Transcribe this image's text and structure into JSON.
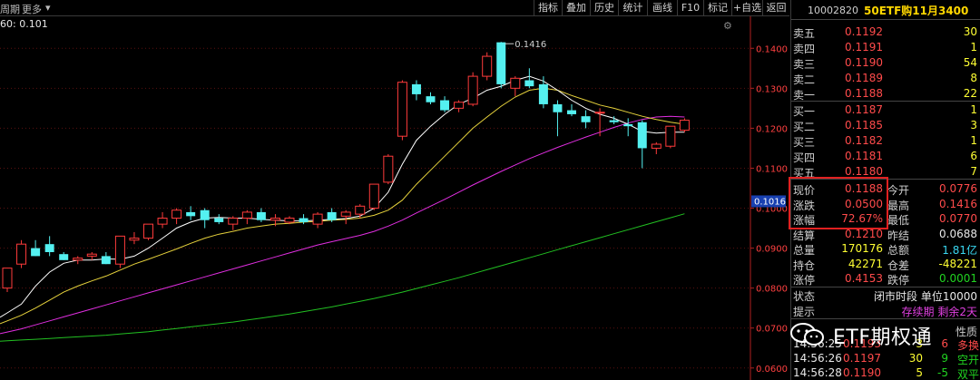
{
  "toolbar": {
    "left_label": "周期",
    "more_label": "更多",
    "buttons": [
      "指标",
      "叠加",
      "历史",
      "统计",
      "画线",
      "F10",
      "标记",
      "+自选",
      "返回"
    ]
  },
  "ma_label": "60: 0.101",
  "chart_data": {
    "type": "candlestick",
    "ylim": [
      0.057,
      0.148
    ],
    "y_ticks": [
      "0.1400",
      "0.1300",
      "0.1200",
      "0.1100",
      "0.1000",
      "0.0900",
      "0.0800",
      "0.0700",
      "0.0600"
    ],
    "tick_values": [
      0.14,
      0.13,
      0.12,
      0.11,
      0.1,
      0.09,
      0.08,
      0.07,
      0.06
    ],
    "current_value_tag": "0.1016",
    "high_label": "0.1416",
    "colors": {
      "up": "#ff3b3b",
      "down": "#54f0f0",
      "ma5": "#ffffff",
      "ma10": "#e6d23c",
      "ma20": "#e02ee0",
      "ma60": "#22c022"
    },
    "candles": [
      [
        0.08,
        0.085,
        0.079,
        0.085
      ],
      [
        0.086,
        0.092,
        0.085,
        0.091
      ],
      [
        0.09,
        0.092,
        0.088,
        0.088
      ],
      [
        0.091,
        0.093,
        0.088,
        0.089
      ],
      [
        0.0885,
        0.089,
        0.087,
        0.087
      ],
      [
        0.087,
        0.088,
        0.086,
        0.0875
      ],
      [
        0.088,
        0.089,
        0.087,
        0.0885
      ],
      [
        0.088,
        0.089,
        0.086,
        0.086
      ],
      [
        0.086,
        0.093,
        0.085,
        0.093
      ],
      [
        0.092,
        0.094,
        0.091,
        0.0925
      ],
      [
        0.0925,
        0.096,
        0.092,
        0.096
      ],
      [
        0.096,
        0.099,
        0.095,
        0.0975
      ],
      [
        0.0975,
        0.1,
        0.096,
        0.0995
      ],
      [
        0.099,
        0.1005,
        0.097,
        0.098
      ],
      [
        0.0995,
        0.1,
        0.095,
        0.097
      ],
      [
        0.0975,
        0.0985,
        0.096,
        0.0965
      ],
      [
        0.096,
        0.098,
        0.0945,
        0.0975
      ],
      [
        0.0975,
        0.0995,
        0.096,
        0.099
      ],
      [
        0.099,
        0.1,
        0.0965,
        0.097
      ],
      [
        0.097,
        0.0985,
        0.0955,
        0.0975
      ],
      [
        0.0965,
        0.098,
        0.096,
        0.0975
      ],
      [
        0.0975,
        0.0985,
        0.096,
        0.0965
      ],
      [
        0.096,
        0.099,
        0.095,
        0.0985
      ],
      [
        0.099,
        0.1,
        0.0965,
        0.097
      ],
      [
        0.098,
        0.0995,
        0.096,
        0.099
      ],
      [
        0.0985,
        0.101,
        0.0975,
        0.1005
      ],
      [
        0.1,
        0.106,
        0.0995,
        0.106
      ],
      [
        0.1065,
        0.1135,
        0.106,
        0.113
      ],
      [
        0.118,
        0.132,
        0.117,
        0.1315
      ],
      [
        0.131,
        0.132,
        0.127,
        0.1285
      ],
      [
        0.128,
        0.129,
        0.126,
        0.1265
      ],
      [
        0.127,
        0.128,
        0.124,
        0.1245
      ],
      [
        0.125,
        0.127,
        0.124,
        0.1265
      ],
      [
        0.126,
        0.134,
        0.1255,
        0.133
      ],
      [
        0.133,
        0.139,
        0.132,
        0.138
      ],
      [
        0.1415,
        0.1416,
        0.13,
        0.131
      ],
      [
        0.13,
        0.133,
        0.128,
        0.1325
      ],
      [
        0.132,
        0.135,
        0.13,
        0.1305
      ],
      [
        0.131,
        0.133,
        0.125,
        0.126
      ],
      [
        0.126,
        0.127,
        0.118,
        0.124
      ],
      [
        0.1245,
        0.126,
        0.123,
        0.1235
      ],
      [
        0.123,
        0.1245,
        0.12,
        0.1215
      ],
      [
        0.124,
        0.125,
        0.118,
        0.124
      ],
      [
        0.122,
        0.123,
        0.121,
        0.1215
      ],
      [
        0.121,
        0.1225,
        0.118,
        0.1205
      ],
      [
        0.1215,
        0.122,
        0.11,
        0.115
      ],
      [
        0.115,
        0.1165,
        0.1135,
        0.116
      ],
      [
        0.1155,
        0.1205,
        0.115,
        0.1205
      ],
      [
        0.1195,
        0.1225,
        0.119,
        0.122
      ]
    ],
    "ma5": [
      0.0738,
      0.076,
      0.0805,
      0.084,
      0.0862,
      0.087,
      0.087,
      0.0873,
      0.0872,
      0.088,
      0.09,
      0.0925,
      0.095,
      0.0965,
      0.0975,
      0.0977,
      0.0975,
      0.0975,
      0.0972,
      0.097,
      0.0968,
      0.0968,
      0.097,
      0.0972,
      0.0974,
      0.098,
      0.1,
      0.104,
      0.111,
      0.117,
      0.1205,
      0.1235,
      0.126,
      0.1275,
      0.1295,
      0.1305,
      0.132,
      0.133,
      0.1318,
      0.1295,
      0.127,
      0.125,
      0.1235,
      0.1225,
      0.121,
      0.1192,
      0.1188,
      0.119,
      0.119
    ],
    "ma10": [
      0.0718,
      0.0732,
      0.075,
      0.077,
      0.079,
      0.0805,
      0.0818,
      0.083,
      0.0845,
      0.086,
      0.0872,
      0.0885,
      0.0898,
      0.0912,
      0.0925,
      0.0935,
      0.0942,
      0.095,
      0.0955,
      0.096,
      0.0962,
      0.0965,
      0.0967,
      0.097,
      0.0972,
      0.0975,
      0.0982,
      0.0995,
      0.102,
      0.106,
      0.1095,
      0.113,
      0.1165,
      0.12,
      0.1228,
      0.1255,
      0.1278,
      0.1295,
      0.13,
      0.1295,
      0.1282,
      0.127,
      0.1258,
      0.125,
      0.124,
      0.123,
      0.1222,
      0.1215,
      0.121
    ],
    "ma20": [
      0.069,
      0.0698,
      0.0708,
      0.0718,
      0.0728,
      0.0738,
      0.0748,
      0.0758,
      0.0768,
      0.0778,
      0.0788,
      0.0798,
      0.0808,
      0.0818,
      0.0828,
      0.0838,
      0.0848,
      0.0858,
      0.0868,
      0.0878,
      0.0888,
      0.0898,
      0.0908,
      0.0916,
      0.0924,
      0.0932,
      0.0942,
      0.0955,
      0.097,
      0.0988,
      0.1005,
      0.1022,
      0.104,
      0.1058,
      0.1075,
      0.1092,
      0.1108,
      0.1124,
      0.1138,
      0.1152,
      0.1165,
      0.1178,
      0.119,
      0.1202,
      0.1213,
      0.1222,
      0.1228,
      0.123,
      0.1228
    ],
    "ma60": [
      0.0668,
      0.067,
      0.0672,
      0.0674,
      0.0676,
      0.0678,
      0.068,
      0.0682,
      0.0685,
      0.0688,
      0.0691,
      0.0695,
      0.0699,
      0.0703,
      0.0707,
      0.0711,
      0.0715,
      0.072,
      0.0725,
      0.073,
      0.0735,
      0.0741,
      0.0747,
      0.0753,
      0.076,
      0.0767,
      0.0774,
      0.0782,
      0.079,
      0.0799,
      0.0808,
      0.0817,
      0.0826,
      0.0836,
      0.0846,
      0.0856,
      0.0866,
      0.0876,
      0.0886,
      0.0896,
      0.0906,
      0.0916,
      0.0926,
      0.0936,
      0.0946,
      0.0956,
      0.0966,
      0.0976,
      0.0986
    ]
  },
  "quote": {
    "code": "10002820",
    "name": "50ETF购11月3400",
    "asks": [
      {
        "label": "卖五",
        "price": "0.1192",
        "vol": "30"
      },
      {
        "label": "卖四",
        "price": "0.1191",
        "vol": "1"
      },
      {
        "label": "卖三",
        "price": "0.1190",
        "vol": "54"
      },
      {
        "label": "卖二",
        "price": "0.1189",
        "vol": "8"
      },
      {
        "label": "卖一",
        "price": "0.1188",
        "vol": "22"
      }
    ],
    "bids": [
      {
        "label": "买一",
        "price": "0.1187",
        "vol": "1"
      },
      {
        "label": "买二",
        "price": "0.1185",
        "vol": "3"
      },
      {
        "label": "买三",
        "price": "0.1182",
        "vol": "1"
      },
      {
        "label": "买四",
        "price": "0.1181",
        "vol": "6"
      },
      {
        "label": "买五",
        "price": "0.1180",
        "vol": "7"
      }
    ],
    "stats": [
      {
        "k1": "现价",
        "v1": "0.1188",
        "c1": "red",
        "k2": "今开",
        "v2": "0.0776",
        "c2": "red"
      },
      {
        "k1": "涨跌",
        "v1": "0.0500",
        "c1": "red",
        "k2": "最高",
        "v2": "0.1416",
        "c2": "red"
      },
      {
        "k1": "涨幅",
        "v1": "72.67%",
        "c1": "red",
        "k2": "最低",
        "v2": "0.0770",
        "c2": "red"
      },
      {
        "k1": "结算",
        "v1": "0.1210",
        "c1": "red",
        "k2": "昨结",
        "v2": "0.0688",
        "c2": "white"
      },
      {
        "k1": "总量",
        "v1": "170176",
        "c1": "yellow",
        "k2": "总额",
        "v2": "1.81亿",
        "c2": "cyan"
      },
      {
        "k1": "持仓",
        "v1": "42271",
        "c1": "yellow",
        "k2": "仓差",
        "v2": "-48221",
        "c2": "yellow"
      },
      {
        "k1": "涨停",
        "v1": "0.4153",
        "c1": "red",
        "k2": "跌停",
        "v2": "0.0001",
        "c2": "green"
      }
    ],
    "status_label": "状态",
    "status_value": "闭市时段 单位10000",
    "hint_label": "提示",
    "hint_value": "存续期 剩余2天",
    "trades_header": "性质",
    "trades": [
      {
        "time": "14:56:25",
        "price": "0.1193",
        "vol": "3",
        "chg": "6",
        "nature": "多换",
        "chgColor": "red",
        "natColor": "red"
      },
      {
        "time": "14:56:26",
        "price": "0.1197",
        "vol": "30",
        "chg": "9",
        "nature": "空开",
        "chgColor": "green",
        "natColor": "green"
      },
      {
        "time": "14:56:28",
        "price": "0.1190",
        "vol": "5",
        "chg": "-5",
        "nature": "双平",
        "chgColor": "green",
        "natColor": "green"
      }
    ]
  },
  "watermark": "ETF期权通"
}
